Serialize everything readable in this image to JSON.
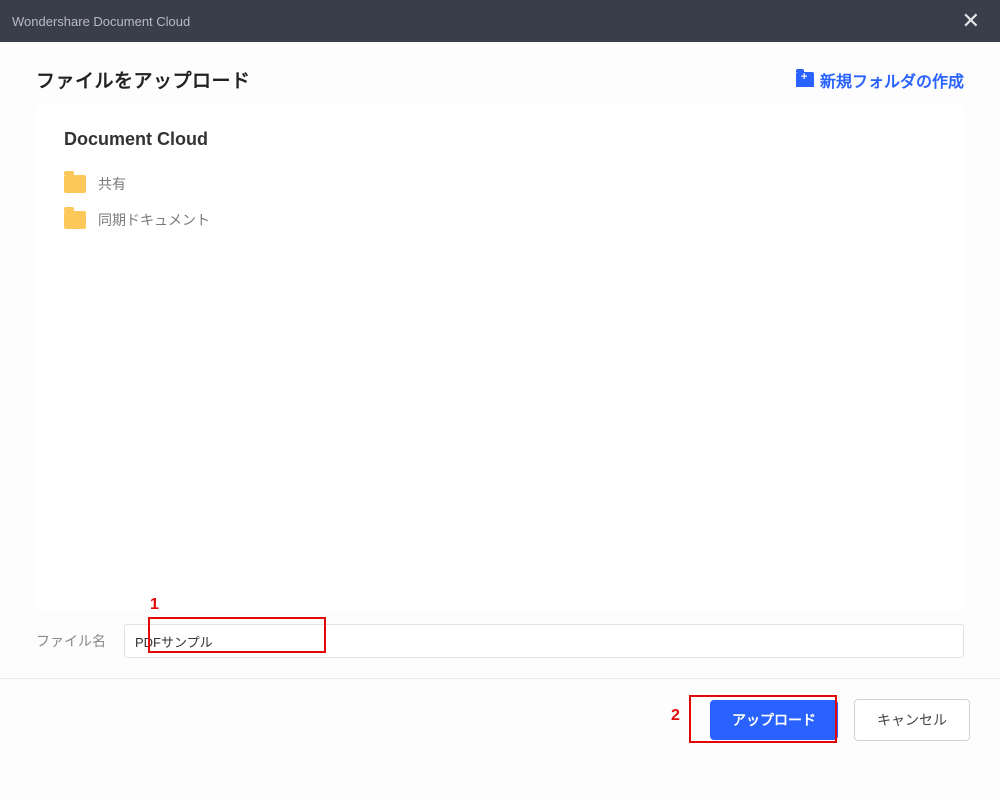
{
  "titlebar": {
    "text": "Wondershare Document Cloud"
  },
  "header": {
    "title": "ファイルをアップロード",
    "new_folder_label": "新規フォルダの作成"
  },
  "breadcrumb": "Document Cloud",
  "folders": [
    {
      "label": "共有"
    },
    {
      "label": "同期ドキュメント"
    }
  ],
  "filename": {
    "label": "ファイル名",
    "value": "PDFサンプル"
  },
  "buttons": {
    "upload": "アップロード",
    "cancel": "キャンセル"
  },
  "annotations": {
    "a1": "1",
    "a2": "2"
  }
}
